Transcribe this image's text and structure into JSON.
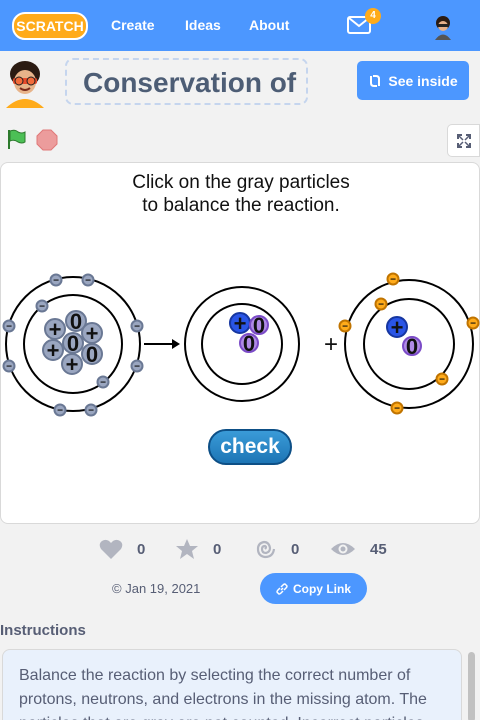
{
  "nav": {
    "logo_text": "SCRATCH",
    "links": [
      "Create",
      "Ideas",
      "About"
    ],
    "messages_count": "4"
  },
  "project": {
    "title": "Conservation of",
    "see_inside_label": "See inside"
  },
  "stage": {
    "instruction_line1": "Click on the gray particles",
    "instruction_line2": "to balance the reaction.",
    "arrow_symbol": "→",
    "plus_symbol": "+",
    "check_label": "check",
    "proton_symbol": "+",
    "neutron_symbol": "0",
    "electron_symbol": "−"
  },
  "stats": {
    "loves": "0",
    "favorites": "0",
    "remixes": "0",
    "views": "45"
  },
  "date": "Jan 19, 2021",
  "copy_link_label": "Copy Link",
  "instructions": {
    "heading": "Instructions",
    "text": "Balance the reaction by selecting the correct number of protons, neutrons, and electrons in the missing atom. The particles that are gray are not counted. Incorrect particles"
  },
  "colors": {
    "brand_blue": "#4c97ff",
    "gray_particle": "#9aa6c0",
    "proton_blue": "#2a55e6",
    "neutron_purple": "#b08ae6",
    "electron_orange": "#ffab1a",
    "check_button": "#1d75b5"
  }
}
